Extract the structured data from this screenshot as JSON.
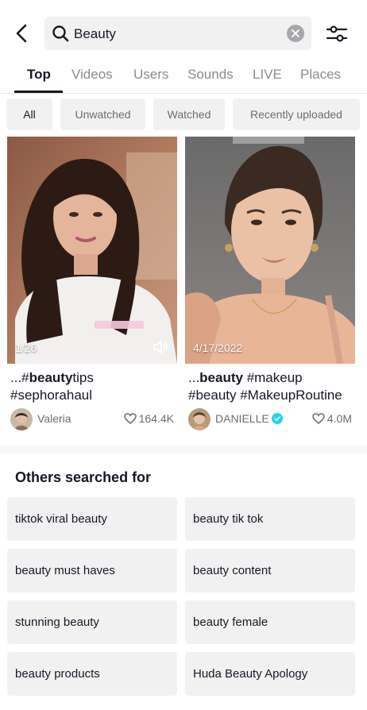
{
  "search": {
    "query": "Beauty"
  },
  "tabs": [
    "Top",
    "Videos",
    "Users",
    "Sounds",
    "LIVE",
    "Places"
  ],
  "chips": [
    "All",
    "Unwatched",
    "Watched",
    "Recently uploaded"
  ],
  "videos": [
    {
      "badge": "1/26",
      "caption_prefix": "...#",
      "caption_bold": "beauty",
      "caption_rest": "tips",
      "caption_line2": "#sephorahaul",
      "author": "Valeria",
      "likes": "164.4K",
      "has_sound_icon": true
    },
    {
      "badge": "4/17/2022",
      "caption_prefix": "...",
      "caption_bold": "beauty",
      "caption_rest": " #makeup",
      "caption_line2": "#beauty #MakeupRoutine",
      "author": "DANIELLE",
      "likes": "4.0M",
      "verified": true
    }
  ],
  "others": {
    "title": "Others searched for",
    "items": [
      "tiktok viral beauty",
      "beauty tik tok",
      "beauty must haves",
      "beauty content",
      "stunning beauty",
      "beauty female",
      "beauty products",
      "Huda Beauty Apology"
    ]
  },
  "colors": {
    "text": "#161823",
    "muted": "#8a8b91",
    "chip_bg": "#f1f1f2",
    "verified": "#20d5ec"
  }
}
